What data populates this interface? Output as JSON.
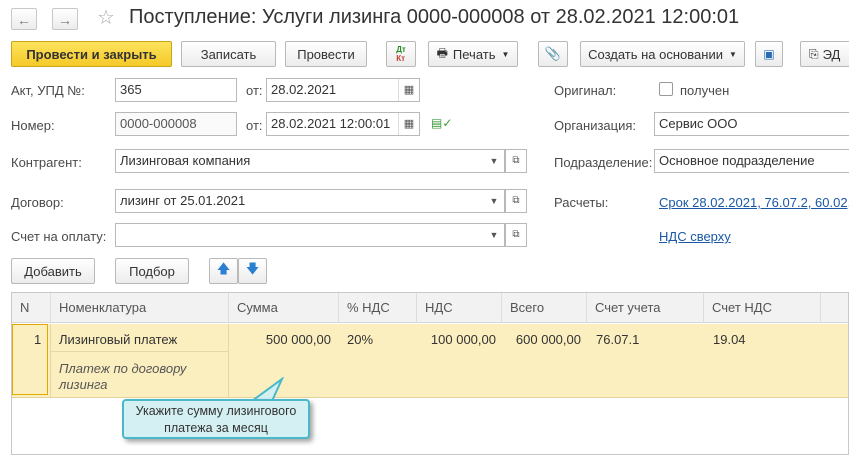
{
  "window": {
    "title": "Поступление: Услуги лизинга 0000-000008 от 28.02.2021 12:00:01"
  },
  "toolbar": {
    "post_close": "Провести и закрыть",
    "write": "Записать",
    "post": "Провести",
    "dt_kt_top": "Дт",
    "dt_kt_bottom": "Кт",
    "print": "Печать",
    "create_based": "Создать на основании",
    "edo": "ЭД"
  },
  "form": {
    "act_label": "Акт, УПД №:",
    "act_value": "365",
    "from_label": "от:",
    "act_date": "28.02.2021",
    "number_label": "Номер:",
    "number_value": "0000-000008",
    "number_date": "28.02.2021 12:00:01",
    "counterparty_label": "Контрагент:",
    "counterparty_value": "Лизинговая компания",
    "contract_label": "Договор:",
    "contract_value": "лизинг от 25.01.2021",
    "invoice_label": "Счет на оплату:",
    "invoice_value": "",
    "original_label": "Оригинал:",
    "original_checkbox_label": "получен",
    "org_label": "Организация:",
    "org_value": "Сервис  ООО",
    "dept_label": "Подразделение:",
    "dept_value": "Основное подразделение",
    "settlements_label": "Расчеты:",
    "settlements_link": "Срок 28.02.2021, 76.07.2, 60.02,",
    "vat_link": "НДС сверху"
  },
  "table_toolbar": {
    "add": "Добавить",
    "select": "Подбор"
  },
  "table": {
    "columns": [
      "N",
      "Номенклатура",
      "Сумма",
      "% НДС",
      "НДС",
      "Всего",
      "Счет учета",
      "Счет НДС"
    ],
    "rows": [
      {
        "n": "1",
        "item": "Лизинговый платеж",
        "item_note_line1": "Платеж по договору",
        "item_note_line2": "лизинга",
        "sum": "500 000,00",
        "vat_rate": "20%",
        "vat": "100 000,00",
        "total": "600 000,00",
        "account": "76.07.1",
        "vat_account": "19.04"
      }
    ]
  },
  "tooltip": {
    "line1": "Укажите сумму лизингового",
    "line2": "платежа за месяц"
  }
}
